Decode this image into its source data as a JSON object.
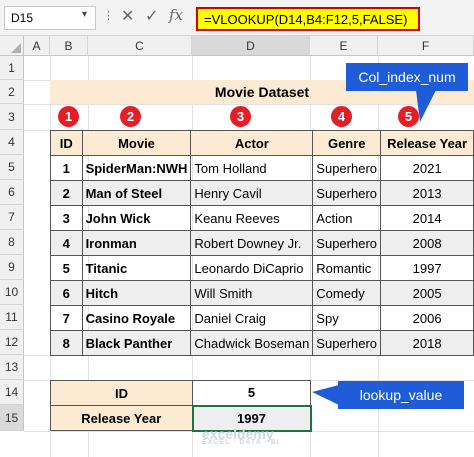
{
  "formula_bar": {
    "name_box": "D15",
    "cancel_icon": "✕",
    "enter_icon": "✓",
    "fx_label": "fx",
    "formula": "=VLOOKUP(D14,B4:F12,5,FALSE)"
  },
  "columns": [
    "A",
    "B",
    "C",
    "D",
    "E",
    "F"
  ],
  "rows": [
    "1",
    "2",
    "3",
    "4",
    "5",
    "6",
    "7",
    "8",
    "9",
    "10",
    "11",
    "12",
    "13",
    "14",
    "15"
  ],
  "title": "Movie Dataset",
  "badges": [
    "1",
    "2",
    "3",
    "4",
    "5"
  ],
  "table": {
    "headers": [
      "ID",
      "Movie",
      "Actor",
      "Genre",
      "Release Year"
    ],
    "rows": [
      [
        "1",
        "SpiderMan:NWH",
        "Tom Holland",
        "Superhero",
        "2021"
      ],
      [
        "2",
        "Man of Steel",
        "Henry Cavil",
        "Superhero",
        "2013"
      ],
      [
        "3",
        "John Wick",
        "Keanu Reeves",
        "Action",
        "2014"
      ],
      [
        "4",
        "Ironman",
        "Robert Downey Jr.",
        "Superhero",
        "2008"
      ],
      [
        "5",
        "Titanic",
        "Leonardo DiCaprio",
        "Romantic",
        "1997"
      ],
      [
        "6",
        "Hitch",
        "Will Smith",
        "Comedy",
        "2005"
      ],
      [
        "7",
        "Casino Royale",
        "Daniel Craig",
        "Spy",
        "2006"
      ],
      [
        "8",
        "Black Panther",
        "Chadwick Boseman",
        "Superhero",
        "2018"
      ]
    ]
  },
  "lookup": {
    "id_label": "ID",
    "id_value": "5",
    "year_label": "Release Year",
    "year_value": "1997"
  },
  "callouts": {
    "col_index": "Col_index_num",
    "lookup_value": "lookup_value"
  },
  "watermark": {
    "name": "exceldemy",
    "tagline": "EXCEL · DATA · BI"
  },
  "colors": {
    "badge": "#e41e26",
    "callout": "#1f5cd8",
    "header_fill": "#fcebd2",
    "formula_highlight": "#ffff00",
    "formula_border": "#d20000"
  }
}
